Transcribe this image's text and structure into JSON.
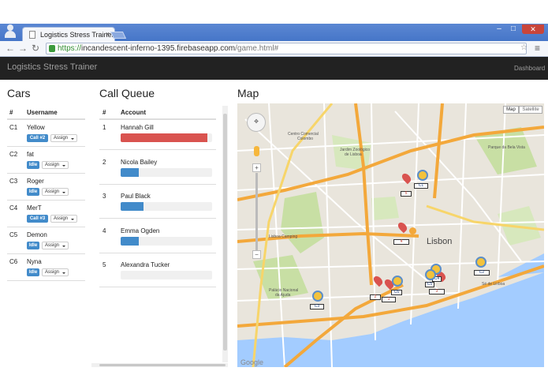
{
  "browser": {
    "tab_title": "Logistics Stress Trainer",
    "url_scheme": "https://",
    "url_host": "incandescent-inferno-1395.firebaseapp.com",
    "url_path": "/game.html#",
    "minimize": "–",
    "maximize": "□",
    "close": "✕"
  },
  "navbar": {
    "brand": "Logistics Stress Trainer",
    "dashboard": "Dashboard"
  },
  "cars": {
    "title": "Cars",
    "col_num": "#",
    "col_user": "Username",
    "assign_label": "Assign",
    "rows": [
      {
        "id": "C1",
        "username": "Yellow",
        "status": "Call #2"
      },
      {
        "id": "C2",
        "username": "fat",
        "status": "Idle"
      },
      {
        "id": "C3",
        "username": "Roger",
        "status": "Idle"
      },
      {
        "id": "C4",
        "username": "MerT",
        "status": "Call #3"
      },
      {
        "id": "C5",
        "username": "Demon",
        "status": "Idle"
      },
      {
        "id": "C6",
        "username": "Nyna",
        "status": "Idle"
      }
    ]
  },
  "queue": {
    "title": "Call Queue",
    "col_num": "#",
    "col_account": "Account",
    "rows": [
      {
        "num": "1",
        "account": "Hannah Gill",
        "progress": 0.95,
        "color": "#d9534f"
      },
      {
        "num": "2",
        "account": "Nicola Bailey",
        "progress": 0.2,
        "color": "#428bca"
      },
      {
        "num": "3",
        "account": "Paul Black",
        "progress": 0.25,
        "color": "#428bca"
      },
      {
        "num": "4",
        "account": "Emma Ogden",
        "progress": 0.2,
        "color": "#428bca"
      },
      {
        "num": "5",
        "account": "Alexandra Tucker",
        "progress": 0.0,
        "color": "#428bca"
      }
    ]
  },
  "map": {
    "title": "Map",
    "type_map": "Map",
    "type_satellite": "Satellite",
    "city_label": "Lisbon",
    "google": "Google",
    "places": [
      "Centro Comercial Colombo",
      "Jardim Zoológico de Lisboa",
      "Parque da Bela Vista",
      "Lisboa Camping",
      "Palácio Nacional da Ajuda",
      "Sé de Lisboa"
    ],
    "call_markers": [
      "5",
      "4",
      "2",
      "1",
      "3"
    ],
    "car_markers": [
      "C1",
      "C2",
      "C3",
      "C4",
      "C5",
      "C6"
    ]
  },
  "colors": {
    "primary": "#428bca",
    "danger": "#d9534f",
    "navbar": "#222222"
  }
}
